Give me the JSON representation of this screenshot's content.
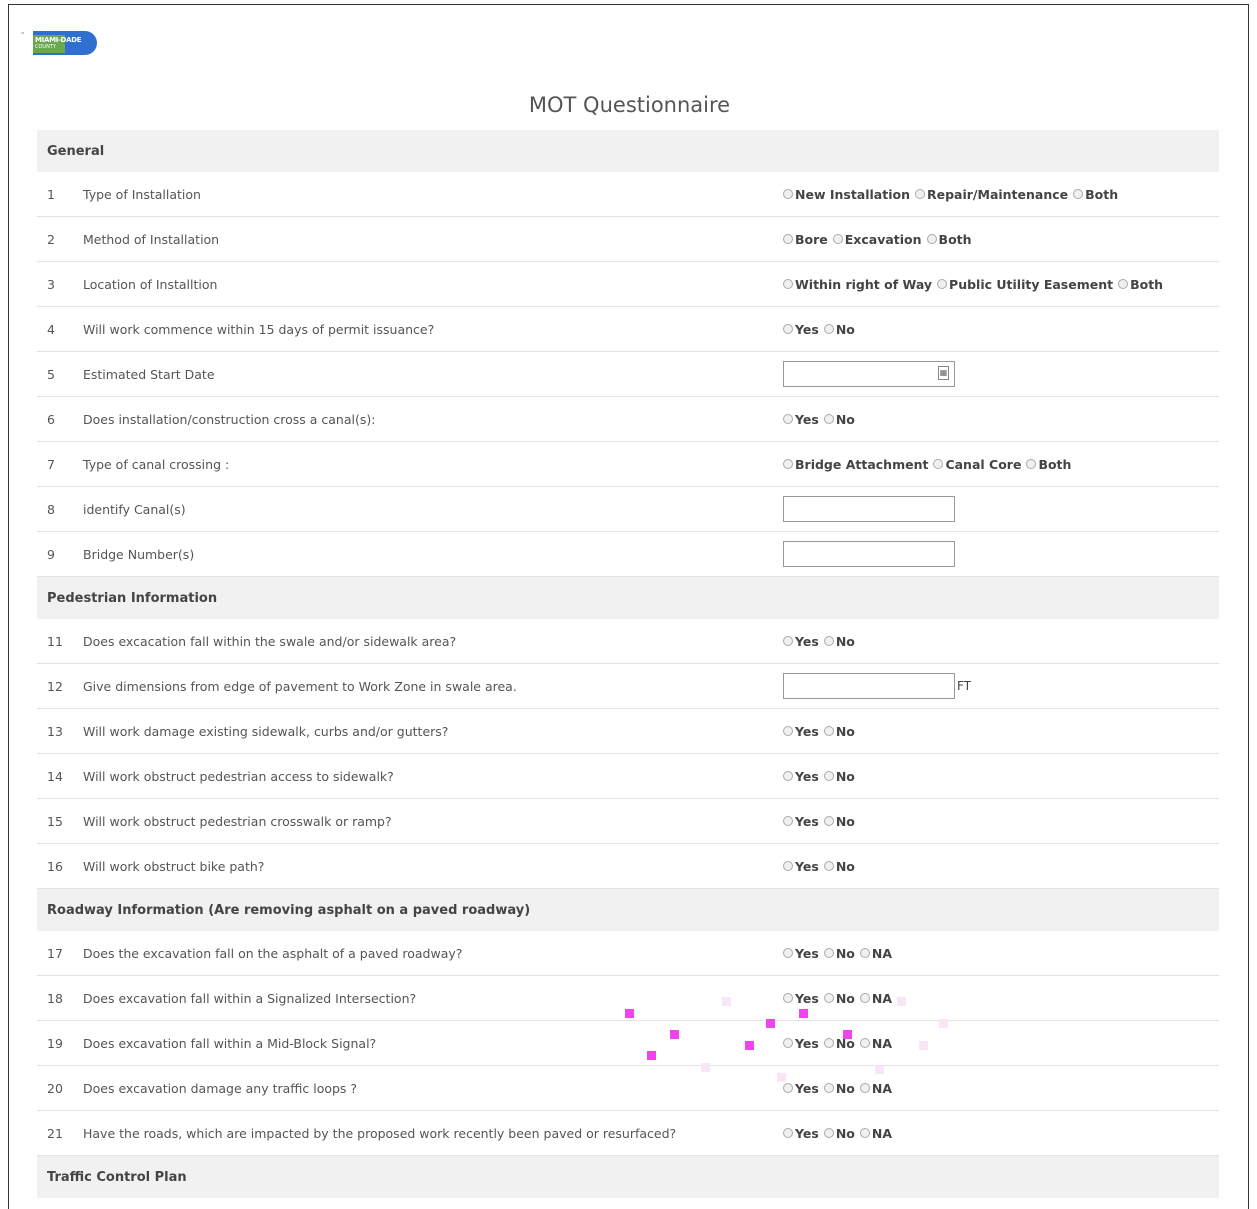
{
  "header": {
    "logo_text": "MIAMI-DADE",
    "logo_sub": "COUNTY",
    "title": "MOT Questionnaire"
  },
  "sections": [
    {
      "label": "General",
      "rows": [
        {
          "num": "1",
          "question": "Type of Installation",
          "type": "radio",
          "options": [
            "New Installation",
            "Repair/Maintenance",
            "Both"
          ]
        },
        {
          "num": "2",
          "question": "Method of Installation",
          "type": "radio",
          "options": [
            "Bore",
            "Excavation",
            "Both"
          ]
        },
        {
          "num": "3",
          "question": "Location of Installtion",
          "type": "radio",
          "options": [
            "Within right of Way",
            "Public Utility Easement",
            "Both"
          ]
        },
        {
          "num": "4",
          "question": "Will work commence within 15 days of permit issuance?",
          "type": "radio",
          "options": [
            "Yes",
            "No"
          ]
        },
        {
          "num": "5",
          "question": "Estimated Start Date",
          "type": "date",
          "value": ""
        },
        {
          "num": "6",
          "question": "Does installation/construction cross a canal(s):",
          "type": "radio",
          "options": [
            "Yes",
            "No"
          ]
        },
        {
          "num": "7",
          "question": "Type of canal crossing :",
          "type": "radio",
          "options": [
            "Bridge Attachment",
            "Canal Core",
            "Both"
          ]
        },
        {
          "num": "8",
          "question": "identify Canal(s)",
          "type": "text",
          "value": ""
        },
        {
          "num": "9",
          "question": "Bridge Number(s)",
          "type": "text",
          "value": ""
        }
      ]
    },
    {
      "label": "Pedestrian Information",
      "rows": [
        {
          "num": "11",
          "question": "Does excacation fall within the swale and/or sidewalk area?",
          "type": "radio",
          "options": [
            "Yes",
            "No"
          ]
        },
        {
          "num": "12",
          "question": "Give dimensions from edge of pavement to Work Zone in swale area.",
          "type": "text",
          "value": "",
          "unit": "FT"
        },
        {
          "num": "13",
          "question": "Will work damage existing sidewalk, curbs and/or gutters?",
          "type": "radio",
          "options": [
            "Yes",
            "No"
          ]
        },
        {
          "num": "14",
          "question": "Will work obstruct pedestrian access to sidewalk?",
          "type": "radio",
          "options": [
            "Yes",
            "No"
          ]
        },
        {
          "num": "15",
          "question": "Will work obstruct pedestrian crosswalk or ramp?",
          "type": "radio",
          "options": [
            "Yes",
            "No"
          ]
        },
        {
          "num": "16",
          "question": "Will work obstruct bike path?",
          "type": "radio",
          "options": [
            "Yes",
            "No"
          ]
        }
      ]
    },
    {
      "label": "Roadway Information (Are removing asphalt on a paved roadway)",
      "rows": [
        {
          "num": "17",
          "question": "Does the excavation fall on the asphalt of a paved roadway?",
          "type": "radio",
          "options": [
            "Yes",
            "No",
            "NA"
          ]
        },
        {
          "num": "18",
          "question": "Does excavation fall within a Signalized Intersection?",
          "type": "radio",
          "options": [
            "Yes",
            "No",
            "NA"
          ]
        },
        {
          "num": "19",
          "question": "Does excavation fall within a Mid-Block Signal?",
          "type": "radio",
          "options": [
            "Yes",
            "No",
            "NA"
          ]
        },
        {
          "num": "20",
          "question": "Does excavation damage any traffic loops ?",
          "type": "radio",
          "options": [
            "Yes",
            "No",
            "NA"
          ]
        },
        {
          "num": "21",
          "question": "Have the roads, which are impacted by the proposed work recently been paved or resurfaced?",
          "type": "radio",
          "options": [
            "Yes",
            "No",
            "NA"
          ]
        }
      ]
    },
    {
      "label": "Traffic Control Plan",
      "rows": []
    }
  ]
}
